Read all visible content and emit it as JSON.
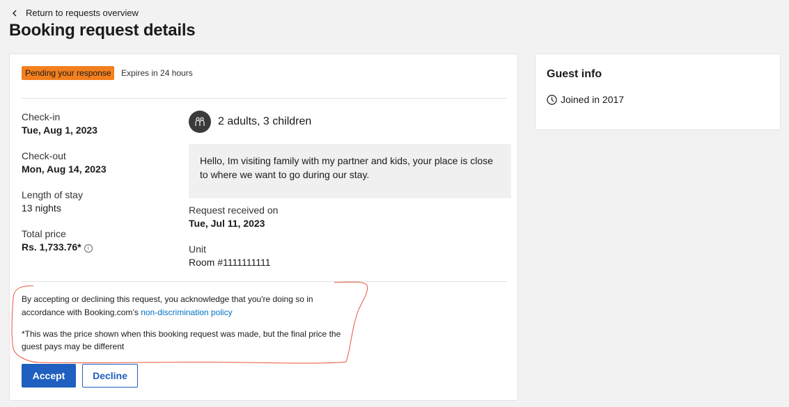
{
  "nav": {
    "back_label": "Return to requests overview"
  },
  "page": {
    "title": "Booking request details"
  },
  "request": {
    "status_badge": "Pending your response",
    "expires": "Expires in 24 hours",
    "checkin_label": "Check-in",
    "checkin_value": "Tue, Aug 1, 2023",
    "checkout_label": "Check-out",
    "checkout_value": "Mon, Aug 14, 2023",
    "stay_label": "Length of stay",
    "stay_value": "13 nights",
    "price_label": "Total price",
    "price_value": "Rs. 1,733.76*",
    "guests": "2 adults, 3 children",
    "message": "Hello, Im visiting family with my partner and kids, your place is close to where we want to go during our stay.",
    "received_label": "Request received on",
    "received_value": "Tue, Jul 11, 2023",
    "unit_label": "Unit",
    "unit_value": "Room #1111111111",
    "ack_text": "By accepting or declining this request, you acknowledge that you're doing so in accordance with Booking.com’s ",
    "ack_link": "non-discrimination policy",
    "price_note": "*This was the price shown when this booking request was made, but the final price the guest pays may be different",
    "accept_label": "Accept",
    "decline_label": "Decline"
  },
  "guest_info": {
    "title": "Guest info",
    "joined": "Joined in 2017"
  },
  "colors": {
    "badge": "#f37f1d",
    "primary": "#1f5fbf",
    "link": "#0071c2",
    "annotation": "#e8563a"
  },
  "icons": {
    "back": "chevron-left-icon",
    "info": "info-icon",
    "guests": "people-icon",
    "joined": "clock-icon"
  }
}
